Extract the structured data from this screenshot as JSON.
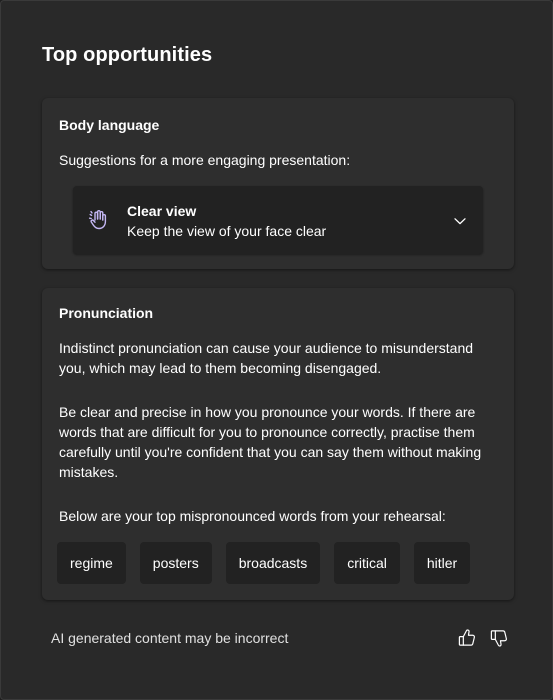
{
  "page": {
    "title": "Top opportunities"
  },
  "body_language": {
    "heading": "Body language",
    "intro": "Suggestions for a more engaging presentation:",
    "suggestion": {
      "icon": "raised-hand-icon",
      "title": "Clear view",
      "description": "Keep the view of your face clear"
    }
  },
  "pronunciation": {
    "heading": "Pronunciation",
    "paragraph_1": "Indistinct pronunciation can cause your audience to misunderstand you, which may lead to them becoming disengaged.",
    "paragraph_2": "Be clear and precise in how you pronounce your words. If there are words that are difficult for you to pronounce correctly, practise them carefully until you're confident that you can say them without making mistakes.",
    "paragraph_3": "Below are your top mispronounced words from your rehearsal:",
    "words": [
      "regime",
      "posters",
      "broadcasts",
      "critical",
      "hitler"
    ]
  },
  "footer": {
    "note": "AI generated content may be incorrect",
    "thumbs_up_icon": "thumbs-up-icon",
    "thumbs_down_icon": "thumbs-down-icon"
  },
  "colors": {
    "panel_bg": "#292929",
    "card_bg": "#2e2e2e",
    "item_bg": "#222222",
    "text": "#ffffff",
    "icon_accent": "#c5b8f5"
  }
}
